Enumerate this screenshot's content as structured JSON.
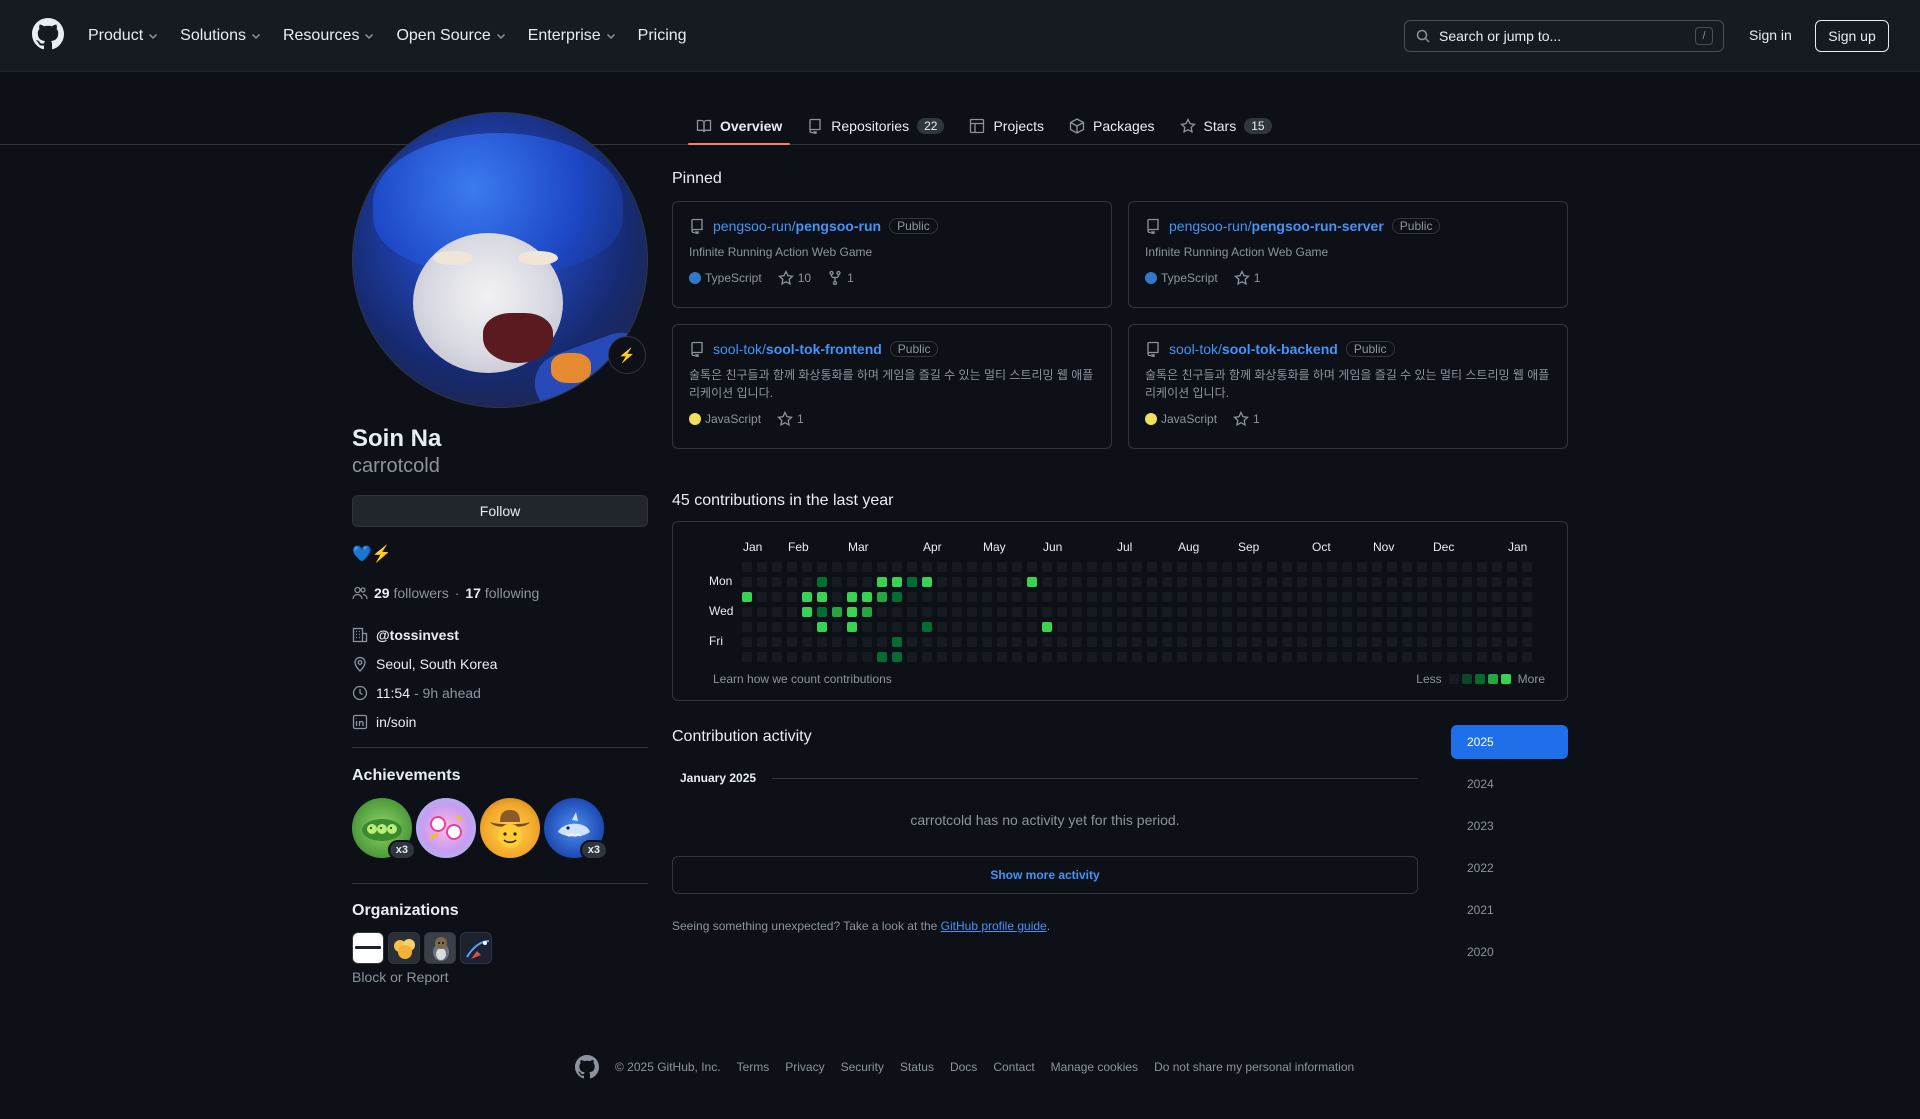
{
  "header": {
    "nav": [
      {
        "label": "Product",
        "has_menu": true
      },
      {
        "label": "Solutions",
        "has_menu": true
      },
      {
        "label": "Resources",
        "has_menu": true
      },
      {
        "label": "Open Source",
        "has_menu": true
      },
      {
        "label": "Enterprise",
        "has_menu": true
      },
      {
        "label": "Pricing",
        "has_menu": false
      }
    ],
    "search_placeholder": "Search or jump to...",
    "search_shortcut": "/",
    "sign_in": "Sign in",
    "sign_up": "Sign up"
  },
  "tabs": [
    {
      "label": "Overview",
      "icon": "book-icon",
      "count": null,
      "active": true
    },
    {
      "label": "Repositories",
      "icon": "repo-icon",
      "count": "22",
      "active": false
    },
    {
      "label": "Projects",
      "icon": "table-icon",
      "count": null,
      "active": false
    },
    {
      "label": "Packages",
      "icon": "package-icon",
      "count": null,
      "active": false
    },
    {
      "label": "Stars",
      "icon": "star-icon",
      "count": "15",
      "active": false
    }
  ],
  "profile": {
    "name": "Soin Na",
    "login": "carrotcold",
    "status_emoji": "⚡",
    "follow_label": "Follow",
    "bio": "💙⚡",
    "followers_count": "29",
    "followers_label": "followers",
    "separator": "·",
    "following_count": "17",
    "following_label": "following",
    "company": "@tossinvest",
    "location": "Seoul, South Korea",
    "local_time": "11:54",
    "time_offset": "- 9h ahead",
    "linkedin": "in/soin"
  },
  "achievements": {
    "title": "Achievements",
    "badges": [
      {
        "name": "peas-badge",
        "multiplier": "x3"
      },
      {
        "name": "yolo-badge",
        "multiplier": null
      },
      {
        "name": "cowboy-badge",
        "multiplier": null
      },
      {
        "name": "shark-badge",
        "multiplier": "x3"
      }
    ]
  },
  "organizations": {
    "title": "Organizations",
    "block_report": "Block or Report"
  },
  "pinned": {
    "title": "Pinned",
    "items": [
      {
        "owner": "pengsoo-run/",
        "repo": "pengsoo-run",
        "visibility": "Public",
        "description": "Infinite Running Action Web Game",
        "language": "TypeScript",
        "lang_color": "#3178c6",
        "stars": "10",
        "forks": "1"
      },
      {
        "owner": "pengsoo-run/",
        "repo": "pengsoo-run-server",
        "visibility": "Public",
        "description": "Infinite Running Action Web Game",
        "language": "TypeScript",
        "lang_color": "#3178c6",
        "stars": "1",
        "forks": null
      },
      {
        "owner": "sool-tok/",
        "repo": "sool-tok-frontend",
        "visibility": "Public",
        "description": "술톡은 친구들과 함께 화상통화를 하며 게임을 즐길 수 있는 멀티 스트리밍 웹 애플리케이션 입니다.",
        "language": "JavaScript",
        "lang_color": "#f1e05a",
        "stars": "1",
        "forks": null
      },
      {
        "owner": "sool-tok/",
        "repo": "sool-tok-backend",
        "visibility": "Public",
        "description": "술톡은 친구들과 함께 화상통화를 하며 게임을 즐길 수 있는 멀티 스트리밍 웹 애플리케이션 입니다.",
        "language": "JavaScript",
        "lang_color": "#f1e05a",
        "stars": "1",
        "forks": null
      }
    ]
  },
  "contributions": {
    "title": "45 contributions in the last year",
    "months": [
      "Jan",
      "Feb",
      "Mar",
      "Apr",
      "May",
      "Jun",
      "Jul",
      "Aug",
      "Sep",
      "Oct",
      "Nov",
      "Dec",
      "Jan"
    ],
    "days": [
      "Mon",
      "Wed",
      "Fri"
    ],
    "learn_link": "Learn how we count contributions",
    "less": "Less",
    "more": "More",
    "colors": [
      "#161b22",
      "#0e4429",
      "#006d32",
      "#26a641",
      "#39d353"
    ],
    "active_cells": [
      {
        "week": 0,
        "day": 2,
        "level": 4
      },
      {
        "week": 4,
        "day": 2,
        "level": 4
      },
      {
        "week": 4,
        "day": 3,
        "level": 4
      },
      {
        "week": 5,
        "day": 1,
        "level": 2
      },
      {
        "week": 5,
        "day": 2,
        "level": 4
      },
      {
        "week": 5,
        "day": 3,
        "level": 2
      },
      {
        "week": 5,
        "day": 4,
        "level": 4
      },
      {
        "week": 6,
        "day": 3,
        "level": 3
      },
      {
        "week": 7,
        "day": 2,
        "level": 4
      },
      {
        "week": 7,
        "day": 3,
        "level": 4
      },
      {
        "week": 7,
        "day": 4,
        "level": 4
      },
      {
        "week": 8,
        "day": 2,
        "level": 4
      },
      {
        "week": 8,
        "day": 3,
        "level": 3
      },
      {
        "week": 9,
        "day": 1,
        "level": 4
      },
      {
        "week": 9,
        "day": 2,
        "level": 3
      },
      {
        "week": 9,
        "day": 6,
        "level": 2
      },
      {
        "week": 10,
        "day": 1,
        "level": 4
      },
      {
        "week": 10,
        "day": 2,
        "level": 2
      },
      {
        "week": 10,
        "day": 5,
        "level": 2
      },
      {
        "week": 10,
        "day": 6,
        "level": 2
      },
      {
        "week": 11,
        "day": 1,
        "level": 2
      },
      {
        "week": 12,
        "day": 1,
        "level": 4
      },
      {
        "week": 12,
        "day": 4,
        "level": 2
      },
      {
        "week": 19,
        "day": 1,
        "level": 4
      },
      {
        "week": 20,
        "day": 4,
        "level": 4
      }
    ]
  },
  "activity": {
    "title": "Contribution activity",
    "month": "January 2025",
    "no_activity": "carrotcold has no activity yet for this period.",
    "show_more": "Show more activity",
    "unexpected_prefix": "Seeing something unexpected? Take a look at the",
    "guide_link": "GitHub profile guide",
    "unexpected_suffix": ".",
    "years": [
      {
        "label": "2025",
        "active": true
      },
      {
        "label": "2024",
        "active": false
      },
      {
        "label": "2023",
        "active": false
      },
      {
        "label": "2022",
        "active": false
      },
      {
        "label": "2021",
        "active": false
      },
      {
        "label": "2020",
        "active": false
      }
    ]
  },
  "footer": {
    "copyright": "© 2025 GitHub, Inc.",
    "links": [
      "Terms",
      "Privacy",
      "Security",
      "Status",
      "Docs",
      "Contact",
      "Manage cookies",
      "Do not share my personal information"
    ]
  }
}
